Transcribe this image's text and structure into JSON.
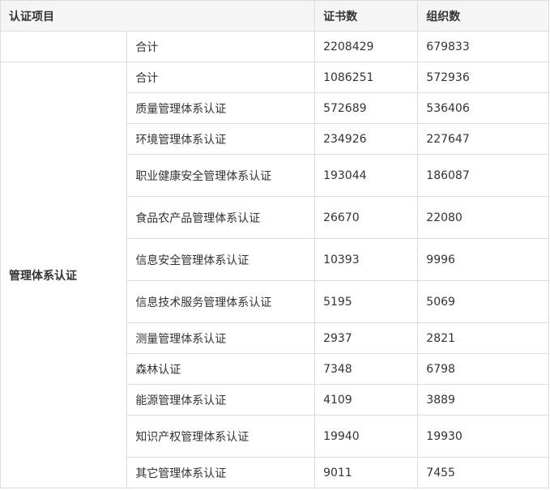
{
  "table": {
    "headers": [
      "认证项目",
      "证书数",
      "组织数"
    ],
    "total_row": {
      "item": "合计",
      "certs": "2208429",
      "orgs": "679833"
    },
    "group_label": "管理体系认证",
    "rows": [
      {
        "item": "合计",
        "certs": "1086251",
        "orgs": "572936"
      },
      {
        "item": "质量管理体系认证",
        "certs": "572689",
        "orgs": "536406"
      },
      {
        "item": "环境管理体系认证",
        "certs": "234926",
        "orgs": "227647"
      },
      {
        "item": "职业健康安全管理体系认证",
        "certs": "193044",
        "orgs": "186087"
      },
      {
        "item": "食品农产品管理体系认证",
        "certs": "26670",
        "orgs": "22080"
      },
      {
        "item": "信息安全管理体系认证",
        "certs": "10393",
        "orgs": "9996"
      },
      {
        "item": "信息技术服务管理体系认证",
        "certs": "5195",
        "orgs": "5069"
      },
      {
        "item": "测量管理体系认证",
        "certs": "2937",
        "orgs": "2821"
      },
      {
        "item": "森林认证",
        "certs": "7348",
        "orgs": "6798"
      },
      {
        "item": "能源管理体系认证",
        "certs": "4109",
        "orgs": "3889"
      },
      {
        "item": "知识产权管理体系认证",
        "certs": "19940",
        "orgs": "19930"
      },
      {
        "item": "其它管理体系认证",
        "certs": "9011",
        "orgs": "7455"
      }
    ]
  }
}
